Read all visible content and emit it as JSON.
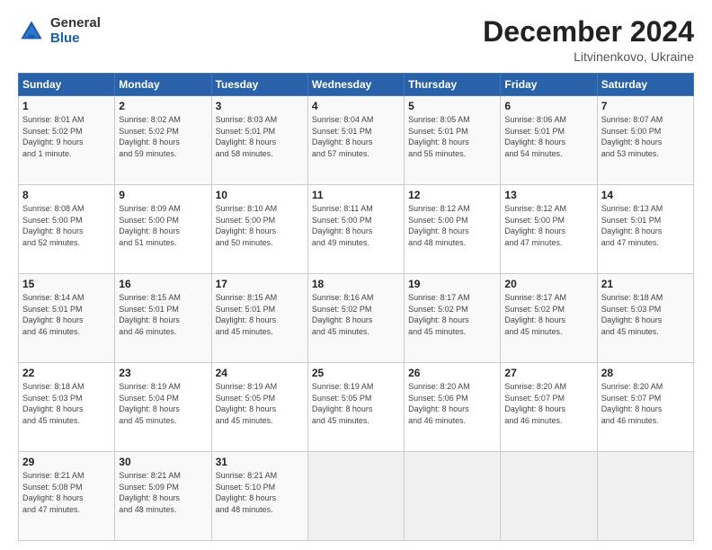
{
  "logo": {
    "general": "General",
    "blue": "Blue"
  },
  "title": {
    "month": "December 2024",
    "location": "Litvinenkovo, Ukraine"
  },
  "weekdays": [
    "Sunday",
    "Monday",
    "Tuesday",
    "Wednesday",
    "Thursday",
    "Friday",
    "Saturday"
  ],
  "weeks": [
    [
      {
        "day": "1",
        "info": "Sunrise: 8:01 AM\nSunset: 5:02 PM\nDaylight: 9 hours\nand 1 minute."
      },
      {
        "day": "2",
        "info": "Sunrise: 8:02 AM\nSunset: 5:02 PM\nDaylight: 8 hours\nand 59 minutes."
      },
      {
        "day": "3",
        "info": "Sunrise: 8:03 AM\nSunset: 5:01 PM\nDaylight: 8 hours\nand 58 minutes."
      },
      {
        "day": "4",
        "info": "Sunrise: 8:04 AM\nSunset: 5:01 PM\nDaylight: 8 hours\nand 57 minutes."
      },
      {
        "day": "5",
        "info": "Sunrise: 8:05 AM\nSunset: 5:01 PM\nDaylight: 8 hours\nand 55 minutes."
      },
      {
        "day": "6",
        "info": "Sunrise: 8:06 AM\nSunset: 5:01 PM\nDaylight: 8 hours\nand 54 minutes."
      },
      {
        "day": "7",
        "info": "Sunrise: 8:07 AM\nSunset: 5:00 PM\nDaylight: 8 hours\nand 53 minutes."
      }
    ],
    [
      {
        "day": "8",
        "info": "Sunrise: 8:08 AM\nSunset: 5:00 PM\nDaylight: 8 hours\nand 52 minutes."
      },
      {
        "day": "9",
        "info": "Sunrise: 8:09 AM\nSunset: 5:00 PM\nDaylight: 8 hours\nand 51 minutes."
      },
      {
        "day": "10",
        "info": "Sunrise: 8:10 AM\nSunset: 5:00 PM\nDaylight: 8 hours\nand 50 minutes."
      },
      {
        "day": "11",
        "info": "Sunrise: 8:11 AM\nSunset: 5:00 PM\nDaylight: 8 hours\nand 49 minutes."
      },
      {
        "day": "12",
        "info": "Sunrise: 8:12 AM\nSunset: 5:00 PM\nDaylight: 8 hours\nand 48 minutes."
      },
      {
        "day": "13",
        "info": "Sunrise: 8:12 AM\nSunset: 5:00 PM\nDaylight: 8 hours\nand 47 minutes."
      },
      {
        "day": "14",
        "info": "Sunrise: 8:13 AM\nSunset: 5:01 PM\nDaylight: 8 hours\nand 47 minutes."
      }
    ],
    [
      {
        "day": "15",
        "info": "Sunrise: 8:14 AM\nSunset: 5:01 PM\nDaylight: 8 hours\nand 46 minutes."
      },
      {
        "day": "16",
        "info": "Sunrise: 8:15 AM\nSunset: 5:01 PM\nDaylight: 8 hours\nand 46 minutes."
      },
      {
        "day": "17",
        "info": "Sunrise: 8:15 AM\nSunset: 5:01 PM\nDaylight: 8 hours\nand 45 minutes."
      },
      {
        "day": "18",
        "info": "Sunrise: 8:16 AM\nSunset: 5:02 PM\nDaylight: 8 hours\nand 45 minutes."
      },
      {
        "day": "19",
        "info": "Sunrise: 8:17 AM\nSunset: 5:02 PM\nDaylight: 8 hours\nand 45 minutes."
      },
      {
        "day": "20",
        "info": "Sunrise: 8:17 AM\nSunset: 5:02 PM\nDaylight: 8 hours\nand 45 minutes."
      },
      {
        "day": "21",
        "info": "Sunrise: 8:18 AM\nSunset: 5:03 PM\nDaylight: 8 hours\nand 45 minutes."
      }
    ],
    [
      {
        "day": "22",
        "info": "Sunrise: 8:18 AM\nSunset: 5:03 PM\nDaylight: 8 hours\nand 45 minutes."
      },
      {
        "day": "23",
        "info": "Sunrise: 8:19 AM\nSunset: 5:04 PM\nDaylight: 8 hours\nand 45 minutes."
      },
      {
        "day": "24",
        "info": "Sunrise: 8:19 AM\nSunset: 5:05 PM\nDaylight: 8 hours\nand 45 minutes."
      },
      {
        "day": "25",
        "info": "Sunrise: 8:19 AM\nSunset: 5:05 PM\nDaylight: 8 hours\nand 45 minutes."
      },
      {
        "day": "26",
        "info": "Sunrise: 8:20 AM\nSunset: 5:06 PM\nDaylight: 8 hours\nand 46 minutes."
      },
      {
        "day": "27",
        "info": "Sunrise: 8:20 AM\nSunset: 5:07 PM\nDaylight: 8 hours\nand 46 minutes."
      },
      {
        "day": "28",
        "info": "Sunrise: 8:20 AM\nSunset: 5:07 PM\nDaylight: 8 hours\nand 46 minutes."
      }
    ],
    [
      {
        "day": "29",
        "info": "Sunrise: 8:21 AM\nSunset: 5:08 PM\nDaylight: 8 hours\nand 47 minutes."
      },
      {
        "day": "30",
        "info": "Sunrise: 8:21 AM\nSunset: 5:09 PM\nDaylight: 8 hours\nand 48 minutes."
      },
      {
        "day": "31",
        "info": "Sunrise: 8:21 AM\nSunset: 5:10 PM\nDaylight: 8 hours\nand 48 minutes."
      },
      {
        "day": "",
        "info": ""
      },
      {
        "day": "",
        "info": ""
      },
      {
        "day": "",
        "info": ""
      },
      {
        "day": "",
        "info": ""
      }
    ]
  ]
}
